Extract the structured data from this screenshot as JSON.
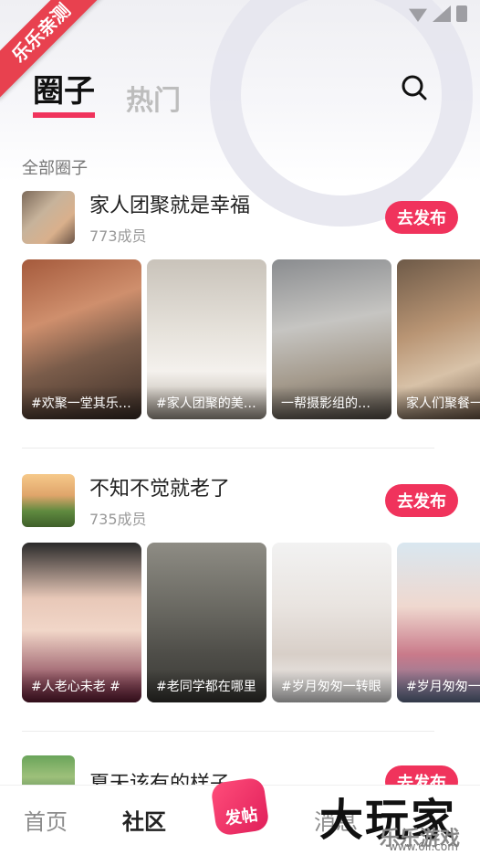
{
  "colors": {
    "accent": "#f0335c",
    "ribbon": "#e8414f"
  },
  "ribbon": {
    "label": "乐乐亲测"
  },
  "tabs": [
    {
      "label": "圈子",
      "active": true
    },
    {
      "label": "热门",
      "active": false
    }
  ],
  "search_icon": "search-icon",
  "section_title": "全部圈子",
  "circles": [
    {
      "name": "家人团聚就是幸福",
      "members": "773成员",
      "post_label": "去发布",
      "posts": [
        {
          "caption": "#欢聚一堂其乐融融"
        },
        {
          "caption": "#家人团聚的美好时光"
        },
        {
          "caption": "一帮摄影组的朋友"
        },
        {
          "caption": "家人们聚餐一"
        }
      ]
    },
    {
      "name": "不知不觉就老了",
      "members": "735成员",
      "post_label": "去发布",
      "posts": [
        {
          "caption": "#人老心未老 #"
        },
        {
          "caption": "#老同学都在哪里"
        },
        {
          "caption": "#岁月匆匆一转眼"
        },
        {
          "caption": "#岁月匆匆一"
        }
      ]
    },
    {
      "name": "夏天该有的样子",
      "post_label": "去发布"
    }
  ],
  "bottom_nav": {
    "home": "首页",
    "community": "社区",
    "publish": "发帖",
    "messages": "消息"
  },
  "watermark": {
    "main": "大玩家",
    "sub": "乐乐游戏",
    "url": "www.6ll.com"
  }
}
